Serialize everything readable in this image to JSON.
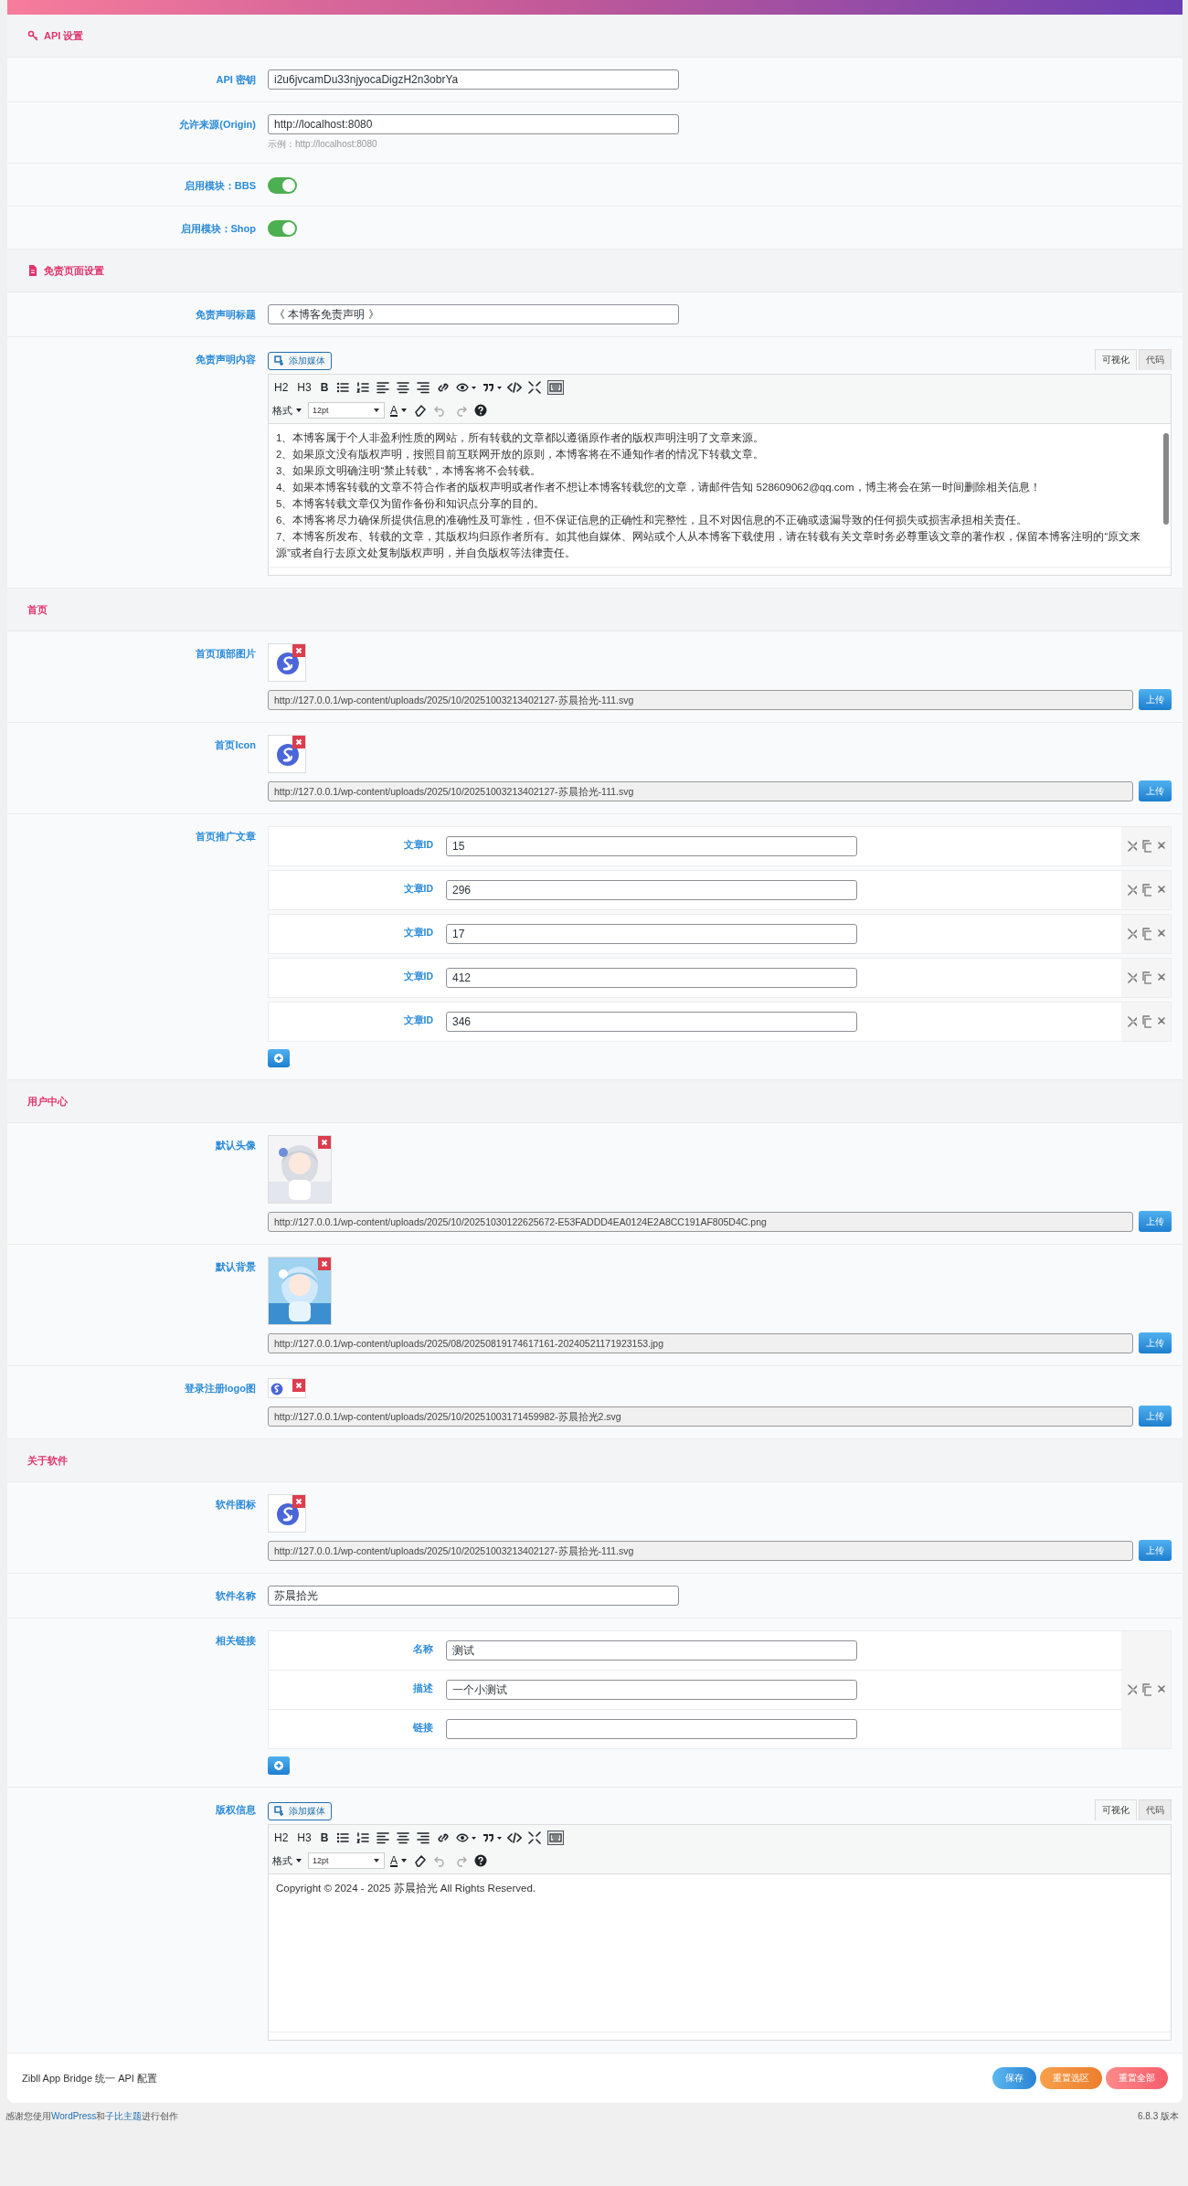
{
  "sections": [
    {
      "title": "API 设置",
      "fields": [
        {
          "kind": "text",
          "label": "API 密钥",
          "value": "i2u6jvcamDu33njyocaDigzH2n3obrYa"
        },
        {
          "kind": "text",
          "label": "允许来源(Origin)",
          "value": "http://localhost:8080",
          "hint": "示例：http://localhost:8080"
        },
        {
          "kind": "switch",
          "label": "启用模块：BBS",
          "on": true
        },
        {
          "kind": "switch",
          "label": "启用模块：Shop",
          "on": true
        }
      ]
    },
    {
      "title": "免责页面设置",
      "fields": [
        {
          "kind": "text",
          "label": "免责声明标题",
          "value": "《 本博客免责声明 》"
        },
        {
          "kind": "editor",
          "label": "免责声明内容",
          "media_button": "添加媒体",
          "tabs": [
            {
              "label": "可视化",
              "selected": true
            },
            {
              "label": "代码",
              "selected": false
            }
          ],
          "toolbar": {
            "h2": "H2",
            "h3": "H3",
            "bold": "B",
            "format": "格式",
            "size": "12pt",
            "text_colour_button": "A"
          },
          "scrollbar": true,
          "paragraphs": [
            "1、本博客属于个人非盈利性质的网站，所有转载的文章都以遵循原作者的版权声明注明了文章来源。",
            "2、如果原文没有版权声明，按照目前互联网开放的原则，本博客将在不通知作者的情况下转载文章。",
            "3、如果原文明确注明“禁止转载”，本博客将不会转载。",
            "4、如果本博客转载的文章不符合作者的版权声明或者作者不想让本博客转载您的文章，请邮件告知 528609062@qq.com，博主将会在第一时间删除相关信息！",
            "5、本博客转载文章仅为留作备份和知识点分享的目的。",
            "6、本博客将尽力确保所提供信息的准确性及可靠性，但不保证信息的正确性和完整性，且不对因信息的不正确或遗漏导致的任何损失或损害承担相关责任。",
            "7、本博客所发布、转载的文章，其版权均归原作者所有。如其他自媒体、网站或个人从本博客下载使用，请在转载有关文章时务必尊重该文章的著作权，保留本博客注明的“原文来源”或者自行去原文处复制版权声明，并自负版权等法律责任。"
          ]
        }
      ]
    },
    {
      "title": "首页",
      "fields": [
        {
          "kind": "upload",
          "label": "首页顶部图片",
          "image": {
            "kind": "logo"
          },
          "url": "http://127.0.0.1/wp-content/uploads/2025/10/20251003213402127-苏晨拾光-111.svg",
          "button": "上传"
        },
        {
          "kind": "upload",
          "label": "首页Icon",
          "image": {
            "kind": "logo"
          },
          "url": "http://127.0.0.1/wp-content/uploads/2025/10/20251003213402127-苏晨拾光-111.svg",
          "button": "上传"
        },
        {
          "kind": "repeater",
          "label": "首页推广文章",
          "items": [
            {
              "fields": [
                {
                  "label": "文章ID",
                  "value": "15"
                }
              ]
            },
            {
              "fields": [
                {
                  "label": "文章ID",
                  "value": "296"
                }
              ]
            },
            {
              "fields": [
                {
                  "label": "文章ID",
                  "value": "17"
                }
              ]
            },
            {
              "fields": [
                {
                  "label": "文章ID",
                  "value": "412"
                }
              ]
            },
            {
              "fields": [
                {
                  "label": "文章ID",
                  "value": "346"
                }
              ]
            }
          ]
        }
      ]
    },
    {
      "title": "用户中心",
      "fields": [
        {
          "kind": "upload",
          "label": "默认头像",
          "url": "http://127.0.0.1/wp-content/uploads/2025/10/20251030122625672-E53FADDD4EA0124E2A8CC191AF805D4C.png",
          "button": "上传"
        },
        {
          "kind": "upload",
          "label": "默认背景",
          "url": "http://127.0.0.1/wp-content/uploads/2025/08/20250819174617161-20240521171923153.jpg",
          "button": "上传"
        },
        {
          "kind": "upload",
          "label": "登录注册logo图",
          "image": {
            "kind": "wide-logo"
          },
          "url": "http://127.0.0.1/wp-content/uploads/2025/10/20251003171459982-苏晨拾光2.svg",
          "button": "上传"
        }
      ]
    },
    {
      "title": "关于软件",
      "fields": [
        {
          "kind": "upload",
          "label": "软件图标",
          "image": {
            "kind": "logo"
          },
          "url": "http://127.0.0.1/wp-content/uploads/2025/10/20251003213402127-苏晨拾光-111.svg",
          "button": "上传"
        },
        {
          "kind": "text",
          "label": "软件名称",
          "value": "苏晨拾光"
        },
        {
          "kind": "repeater",
          "label": "相关链接",
          "items": [
            {
              "fields": [
                {
                  "label": "名称",
                  "value": "测试"
                },
                {
                  "label": "描述",
                  "value": "一个小测试"
                },
                {
                  "label": "链接"
                }
              ]
            }
          ]
        },
        {
          "kind": "editor",
          "label": "版权信息",
          "media_button": "添加媒体",
          "tabs": [
            {
              "label": "可视化",
              "selected": true
            },
            {
              "label": "代码",
              "selected": false
            }
          ],
          "toolbar": {
            "h2": "H2",
            "h3": "H3",
            "bold": "B",
            "format": "格式",
            "size": "12pt",
            "text_colour_button": "A"
          },
          "scrollbar": false,
          "paragraphs": [
            "Copyright © 2024 - 2025 苏晨拾光 All Rights Reserved."
          ]
        }
      ]
    }
  ],
  "footer": {
    "caption": "Zibll App Bridge 统一 API 配置",
    "buttons": [
      {
        "label": "保存",
        "kind": "save"
      },
      {
        "label": "重置选区",
        "kind": "reset-section"
      },
      {
        "label": "重置全部",
        "kind": "reset-all"
      }
    ]
  },
  "bottom": {
    "thanks": [
      {
        "text": "感谢您使用"
      },
      {
        "text": "WordPress",
        "link": true
      },
      {
        "text": "和"
      },
      {
        "text": "子比主题",
        "link": true
      },
      {
        "text": "进行创作"
      }
    ],
    "version": "6.8.3 版本"
  }
}
